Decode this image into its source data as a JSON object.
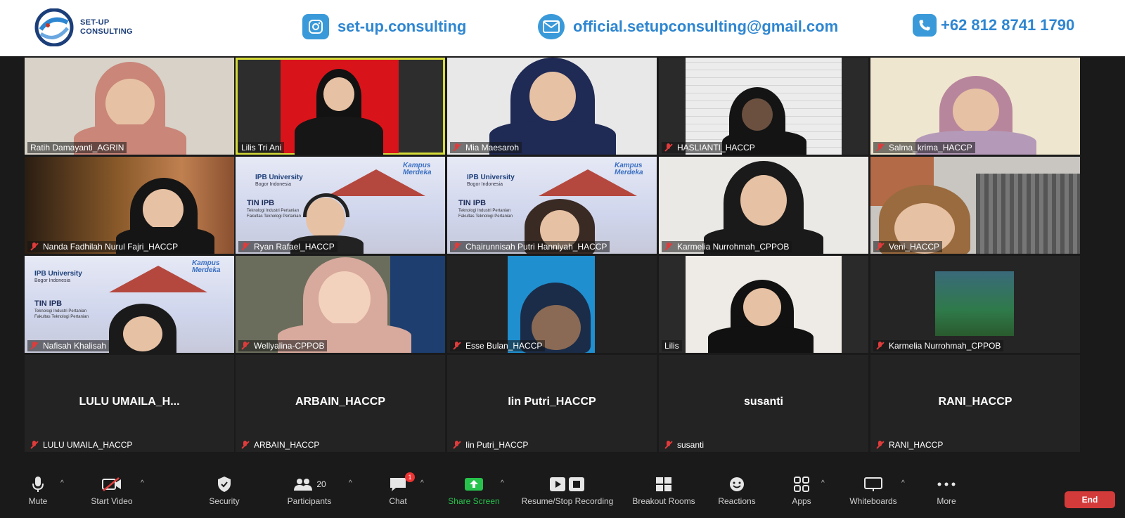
{
  "header": {
    "logo_line1": "SET-UP",
    "logo_line2": "CONSULTING",
    "instagram": "set-up.consulting",
    "email": "official.setupconsulting@gmail.com",
    "phone": "+62 812 8741 1790",
    "accent_color": "#2e86d1"
  },
  "banner_texts": {
    "univ": "IPB University",
    "univ_sub": "Bogor Indonesia",
    "tin": "TIN IPB",
    "tin_sub1": "Teknologi Industri Pertanian",
    "tin_sub2": "Fakultas Teknologi Pertanian",
    "km1": "Kampus",
    "km2": "Merdeka"
  },
  "participants": [
    {
      "name": "Ratih Damayanti_AGRIN",
      "muted": false
    },
    {
      "name": "Lilis Tri Ani",
      "muted": false,
      "active": true
    },
    {
      "name": "Mia Maesaroh",
      "muted": true
    },
    {
      "name": "HASLIANTI_HACCP",
      "muted": true
    },
    {
      "name": "Salma_krima_HACCP",
      "muted": true
    },
    {
      "name": "Nanda Fadhilah Nurul Fajri_HACCP",
      "muted": true
    },
    {
      "name": "Ryan Rafael_HACCP",
      "muted": true
    },
    {
      "name": "Chairunnisah Putri Hanniyah_HACCP",
      "muted": true
    },
    {
      "name": "Karmelia Nurrohmah_CPPOB",
      "muted": true
    },
    {
      "name": "Veni_HACCP",
      "muted": true
    },
    {
      "name": "Nafisah Khalisah",
      "muted": true
    },
    {
      "name": "Wellyalina-CPPOB",
      "muted": true
    },
    {
      "name": "Esse Bulan_HACCP",
      "muted": true
    },
    {
      "name": "Lilis",
      "muted": false
    },
    {
      "name": "Karmelia Nurrohmah_CPPOB",
      "muted": true
    },
    {
      "name": "LULU UMAILA_HACCP",
      "display": "LULU  UMAILA_H...",
      "muted": true
    },
    {
      "name": "ARBAIN_HACCP",
      "display": "ARBAIN_HACCP",
      "muted": true
    },
    {
      "name": "Iin Putri_HACCP",
      "display": "Iin Putri_HACCP",
      "muted": true
    },
    {
      "name": "susanti",
      "display": "susanti",
      "muted": true
    },
    {
      "name": "RANI_HACCP",
      "display": "RANI_HACCP",
      "muted": true
    }
  ],
  "toolbar": {
    "mute": "Mute",
    "start_video": "Start Video",
    "security": "Security",
    "participants": "Participants",
    "participants_count": "20",
    "chat": "Chat",
    "chat_badge": "1",
    "share_screen": "Share Screen",
    "recording": "Resume/Stop Recording",
    "breakout": "Breakout Rooms",
    "reactions": "Reactions",
    "apps": "Apps",
    "whiteboards": "Whiteboards",
    "more": "More",
    "end": "End",
    "caret": "^",
    "end_color": "#d33b3b",
    "share_color": "#27c24c"
  }
}
